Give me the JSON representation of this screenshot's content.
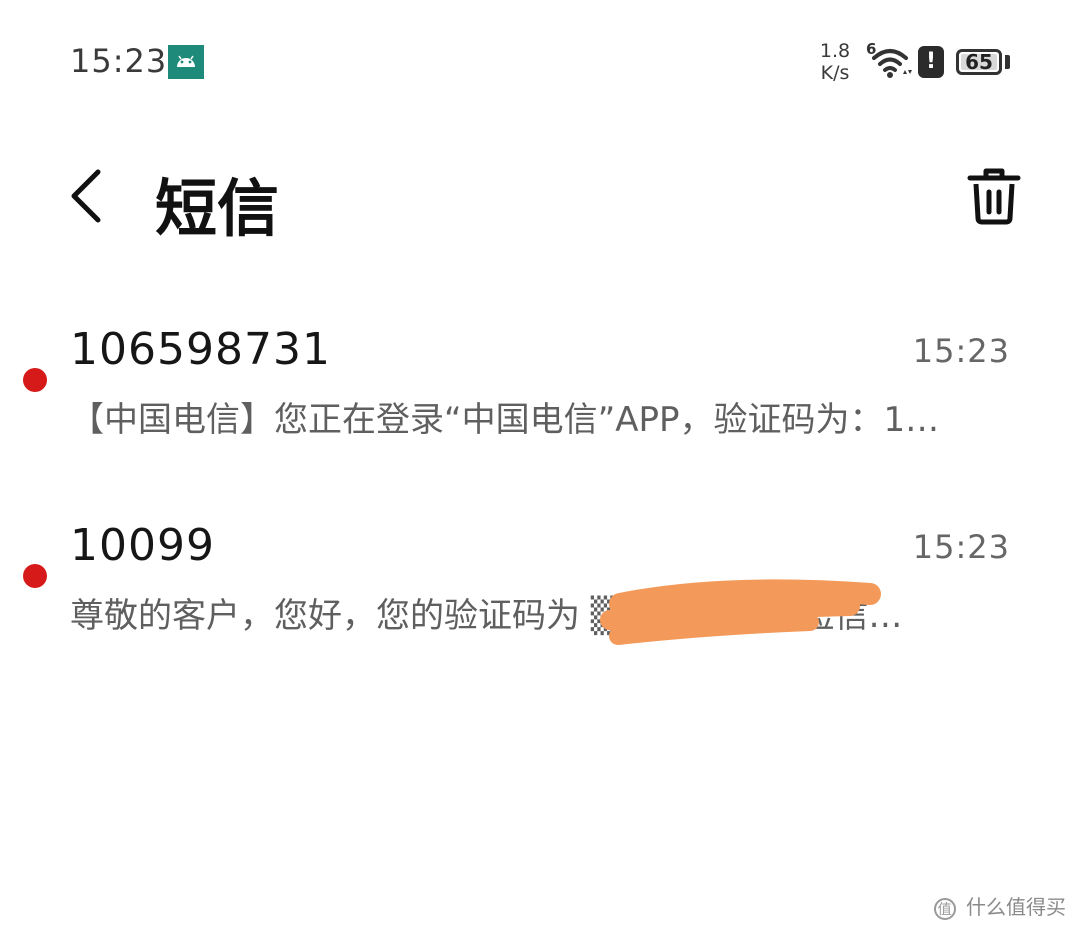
{
  "status_bar": {
    "time": "15:23",
    "net_speed_value": "1.8",
    "net_speed_unit": "K/s",
    "wifi_label": "6",
    "alert_label": "!",
    "battery_level": "65"
  },
  "header": {
    "title": "短信"
  },
  "messages": [
    {
      "sender": "106598731",
      "time": "15:23",
      "preview": "【中国电信】您正在登录“中国电信”APP，验证码为：1…",
      "unread": true
    },
    {
      "sender": "10099",
      "time": "15:23",
      "preview": "尊敬的客户，您好，您的验证码为 ▒▒▒▒▒ 本条短信…",
      "unread": true
    }
  ],
  "watermark": {
    "text": "什么值得买"
  },
  "colors": {
    "unread_dot": "#d61a1a",
    "redaction": "#f39a5a"
  }
}
